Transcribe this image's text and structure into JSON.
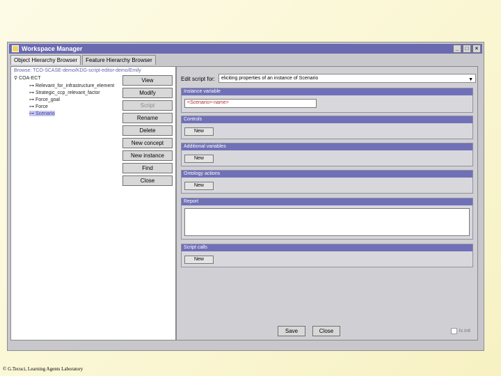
{
  "window": {
    "title": "Workspace Manager",
    "controls": [
      "_",
      "□",
      "×"
    ]
  },
  "tabs": [
    {
      "label": "Object Hierarchy Browser"
    },
    {
      "label": "Feature Hierarchy Browser"
    }
  ],
  "tree": {
    "path": "Browse: TCO-SCASE-demo/KDG-script-editor-demo/Emily",
    "root": "COA-ECT",
    "items": [
      {
        "label": "Relevant_for_infrastructure_element"
      },
      {
        "label": "Strategic_ccp_relevant_factor"
      },
      {
        "label": "Force_goal"
      },
      {
        "label": "Force"
      },
      {
        "label": "Scenario"
      }
    ]
  },
  "buttons": {
    "view": "View",
    "modify": "Modify",
    "script": "Script",
    "rename": "Rename",
    "delete": "Delete",
    "new_concept": "New concept",
    "new_instance": "New instance",
    "find": "Find",
    "close": "Close"
  },
  "editor": {
    "edit_label": "Edit script for:",
    "selected": "eliciting properties of an instance of Scenario",
    "sections": {
      "instance_variable": "Instance variable",
      "instance_value": "<Scenario>-name>",
      "controls": "Controls",
      "additional_variables": "Additional variables",
      "ontology_actions": "Ontology actions",
      "report": "Report",
      "script_calls": "Script calls"
    },
    "new_label": "New",
    "save": "Save",
    "close": "Close",
    "is_init": "Is init"
  },
  "footer": "© G.Tecuci, Learning Agents Laboratory"
}
